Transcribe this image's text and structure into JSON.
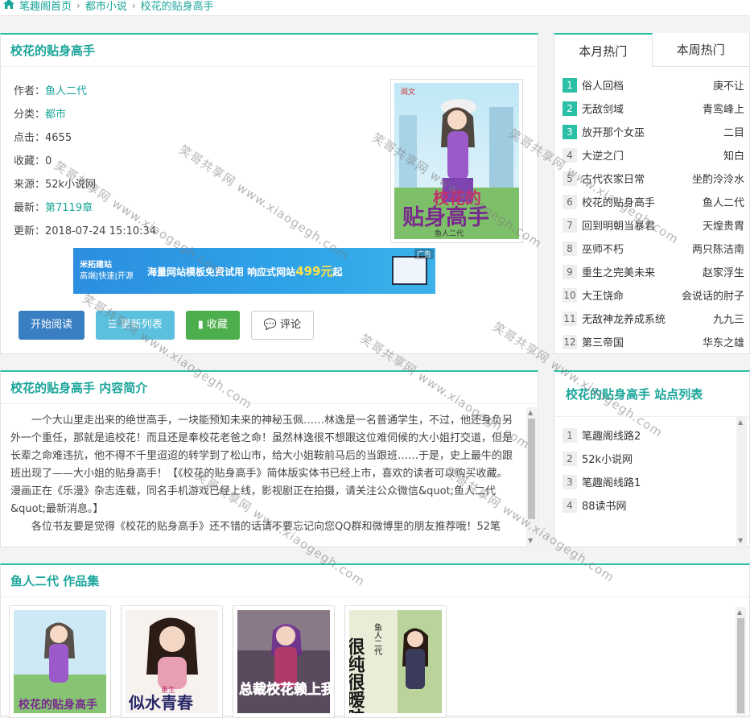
{
  "breadcrumb": {
    "home": "笔趣阁首页",
    "category": "都市小说",
    "current": "校花的贴身高手"
  },
  "book": {
    "title": "校花的贴身高手",
    "author_label": "作者：",
    "author": "鱼人二代",
    "category_label": "分类：",
    "category": "都市",
    "clicks_label": "点击：",
    "clicks": "4655",
    "favorites_label": "收藏：",
    "favorites": "0",
    "source_label": "来源：",
    "source": "52k小说网",
    "latest_label": "最新：",
    "latest": "第7119章",
    "updated_label": "更新：",
    "updated": "2018-07-24 15:10:34",
    "cover": {
      "title_line1": "校花的",
      "title_line2": "贴身高手",
      "author": "鱼人二代",
      "publisher": "阅文"
    }
  },
  "ad": {
    "brand": "米拓建站",
    "brand_sub": "高端|快速|开源",
    "slogan": "海量网站模板免费试用  响应式网站",
    "price": "499元",
    "suffix": "起",
    "tag": "广告"
  },
  "buttons": {
    "start_reading": "开始阅读",
    "update_list": "更新列表",
    "favorite": "收藏",
    "comment": "评论"
  },
  "intro": {
    "title": "校花的贴身高手 内容简介",
    "paragraph1": "一个大山里走出来的绝世高手，一块能预知未来的神秘玉佩……林逸是一名普通学生，不过，他还身负另外一个重任，那就是追校花！而且还是奉校花老爸之命！虽然林逸很不想跟这位难伺候的大小姐打交道，但是长辈之命难违抗，他不得不千里迢迢的转学到了松山市，给大小姐鞍前马后的当跟班……于是，史上最牛的跟班出现了——大小姐的贴身高手！【《校花的贴身高手》简体版实体书已经上市，喜欢的读者可以购买收藏。漫画正在《乐漫》杂志连载，同名手机游戏已经上线，影视剧正在拍摄，请关注公众微信&quot;鱼人二代&quot;最新消息。】",
    "paragraph2": "各位书友要是觉得《校花的贴身高手》还不错的话请不要忘记向您QQ群和微博里的朋友推荐哦！52笔"
  },
  "hot": {
    "tab_month": "本月热门",
    "tab_week": "本周热门",
    "items": [
      {
        "rank": "1",
        "name": "俗人回档",
        "author": "庚不让"
      },
      {
        "rank": "2",
        "name": "无敌剑域",
        "author": "青鸾峰上"
      },
      {
        "rank": "3",
        "name": "放开那个女巫",
        "author": "二目"
      },
      {
        "rank": "4",
        "name": "大逆之门",
        "author": "知白"
      },
      {
        "rank": "5",
        "name": "古代农家日常",
        "author": "坐酌泠泠水"
      },
      {
        "rank": "6",
        "name": "校花的贴身高手",
        "author": "鱼人二代"
      },
      {
        "rank": "7",
        "name": "回到明朝当暴君",
        "author": "天煌贵胄"
      },
      {
        "rank": "8",
        "name": "巫师不朽",
        "author": "两只陈洁南"
      },
      {
        "rank": "9",
        "name": "重生之完美未来",
        "author": "赵家浮生"
      },
      {
        "rank": "10",
        "name": "大王饶命",
        "author": "会说话的肘子"
      },
      {
        "rank": "11",
        "name": "无敌神龙养成系统",
        "author": "九九三"
      },
      {
        "rank": "12",
        "name": "第三帝国",
        "author": "华东之雄"
      }
    ]
  },
  "sites": {
    "title": "校花的贴身高手 站点列表",
    "items": [
      {
        "rank": "1",
        "name": "笔趣阁线路2"
      },
      {
        "rank": "2",
        "name": "52k小说网"
      },
      {
        "rank": "3",
        "name": "笔趣阁线路1"
      },
      {
        "rank": "4",
        "name": "88读书网"
      }
    ]
  },
  "works": {
    "title": "鱼人二代 作品集",
    "items": [
      {
        "cover_title": "校花的贴身高手"
      },
      {
        "cover_title": "似水青春",
        "cover_tag": "重生"
      },
      {
        "cover_title": "总裁校花赖上我"
      },
      {
        "cover_title": "很纯很暧昧",
        "cover_author": "鱼人二代"
      }
    ]
  },
  "watermark": {
    "text": "笑哥共享网 www.xiaogegh.com"
  },
  "colors": {
    "accent": "#1aa59a",
    "border_top": "#2bbfa5",
    "btn_blue": "#3a7fc2",
    "btn_sky": "#5bc0de",
    "btn_green": "#4cae4c"
  }
}
